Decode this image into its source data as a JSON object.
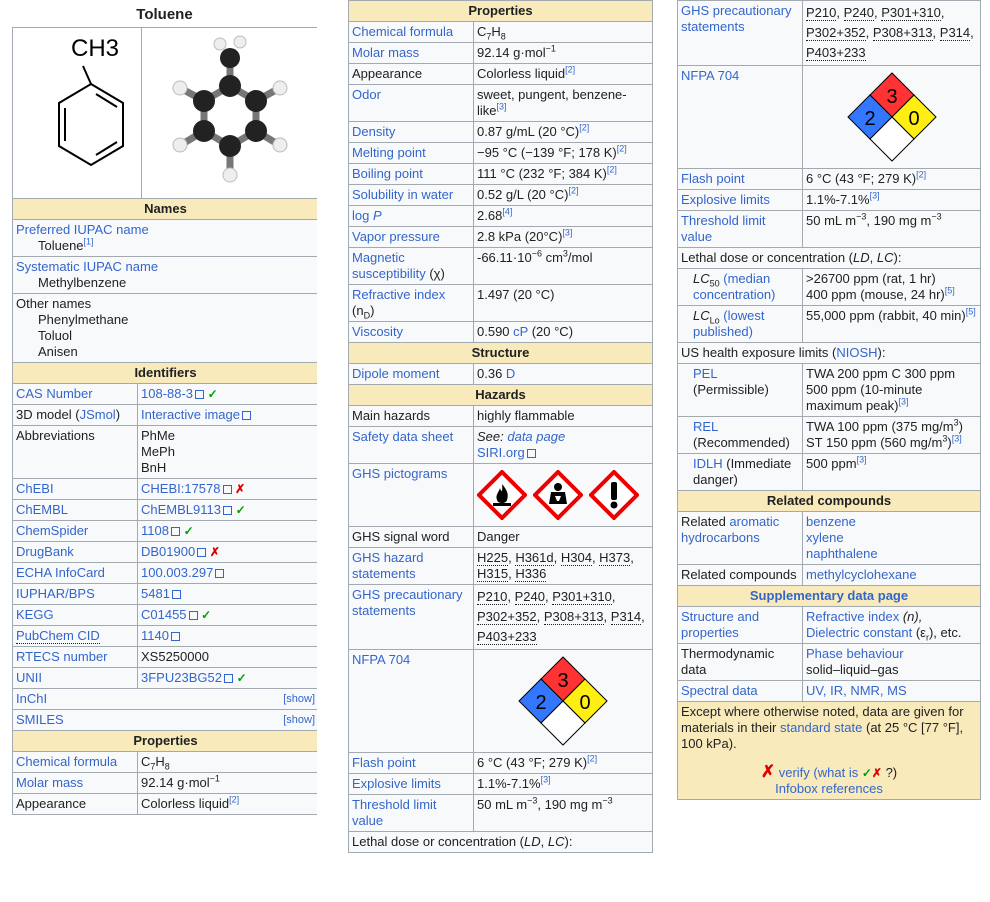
{
  "title": "Toluene",
  "structure": {
    "formula_label": "CH3"
  },
  "sections": {
    "names": "Names",
    "identifiers": "Identifiers",
    "properties": "Properties",
    "structure": "Structure",
    "hazards": "Hazards",
    "related": "Related compounds",
    "supplementary": "Supplementary data page"
  },
  "names": {
    "preferred_label": "Preferred IUPAC name",
    "preferred_value": "Toluene",
    "preferred_ref": "[1]",
    "systematic_label": "Systematic IUPAC name",
    "systematic_value": "Methylbenzene",
    "other_label": "Other names",
    "other_values": [
      "Phenylmethane",
      "Toluol",
      "Anisen"
    ]
  },
  "identifiers": {
    "cas_label": "CAS Number",
    "cas_value": "108-88-3",
    "model_label_a": "3D model (",
    "model_label_link": "JSmol",
    "model_label_b": ")",
    "model_value": "Interactive image",
    "abbr_label": "Abbreviations",
    "abbr_values": [
      "PhMe",
      "MePh",
      "BnH"
    ],
    "chebi_label": "ChEBI",
    "chebi_value": "CHEBI:17578",
    "chembl_label": "ChEMBL",
    "chembl_value": "ChEMBL9113",
    "chemspider_label": "ChemSpider",
    "chemspider_value": "1108",
    "drugbank_label": "DrugBank",
    "drugbank_value": "DB01900",
    "echa_label": "ECHA InfoCard",
    "echa_value": "100.003.297",
    "iuphar_label": "IUPHAR/BPS",
    "iuphar_value": "5481",
    "kegg_label": "KEGG",
    "kegg_value": "C01455",
    "pubchem_label": "PubChem CID",
    "pubchem_value": "1140",
    "rtecs_label": "RTECS number",
    "rtecs_value": "XS5250000",
    "unii_label": "UNII",
    "unii_value": "3FPU23BG52",
    "inchi_label": "InChI",
    "smiles_label": "SMILES",
    "show": "[show]"
  },
  "marks": {
    "check": "✓",
    "cross": "✗"
  },
  "properties": {
    "formula_label": "Chemical formula",
    "formula_c": "C",
    "formula_7": "7",
    "formula_h": "H",
    "formula_8": "8",
    "molar_label": "Molar mass",
    "molar_value": "92.14 g·mol",
    "molar_exp": "−1",
    "appearance_label": "Appearance",
    "appearance_value": "Colorless liquid",
    "appearance_ref": "[2]",
    "odor_label": "Odor",
    "odor_value": "sweet, pungent, benzene-like",
    "odor_ref": "[3]",
    "density_label": "Density",
    "density_value": "0.87 g/mL (20 °C)",
    "density_ref": "[2]",
    "melting_label": "Melting point",
    "melting_value": "−95 °C (−139 °F; 178 K)",
    "melting_ref": "[2]",
    "boiling_label": "Boiling point",
    "boiling_value": "111 °C (232 °F; 384 K)",
    "boiling_ref": "[2]",
    "solubility_label": "Solubility in water",
    "solubility_value": "0.52 g/L (20 °C)",
    "solubility_ref": "[2]",
    "logp_label_a": "log ",
    "logp_label_b": "P",
    "logp_value": "2.68",
    "logp_ref": "[4]",
    "vapor_label": "Vapor pressure",
    "vapor_value": "2.8 kPa (20°C)",
    "vapor_ref": "[3]",
    "magnetic_label": "Magnetic susceptibility",
    "magnetic_chi": "(χ)",
    "magnetic_value_a": "-66.11·10",
    "magnetic_exp": "−6",
    "magnetic_value_b": " cm",
    "magnetic_exp2": "3",
    "magnetic_value_c": "/mol",
    "refractive_label": "Refractive index",
    "refractive_n": "(n",
    "refractive_sub": "D",
    "refractive_close": ")",
    "refractive_value": "1.497 (20 °C)",
    "viscosity_label": "Viscosity",
    "viscosity_value": "0.590 ",
    "viscosity_cp": "cP",
    "viscosity_rest": " (20 °C)"
  },
  "structure_sec": {
    "dipole_label": "Dipole moment",
    "dipole_value": "0.36 ",
    "dipole_unit": "D"
  },
  "hazards": {
    "main_label": "Main hazards",
    "main_value": "highly flammable",
    "sds_label": "Safety data sheet",
    "sds_see": "See: ",
    "sds_link": "data page",
    "sds_siri": "SIRI.org",
    "pict_label": "GHS pictograms",
    "signal_label": "GHS signal word",
    "signal_value": "Danger",
    "hazard_label": "GHS hazard statements",
    "hazard_codes": [
      "H225",
      "H361d",
      "H304",
      "H373",
      "H315",
      "H336"
    ],
    "precaution_label": "GHS precautionary statements",
    "precaution_codes": [
      "P210",
      "P240",
      "P301+310",
      "P302+352",
      "P308+313",
      "P314",
      "P403+233"
    ],
    "nfpa_label": "NFPA 704",
    "nfpa_fire": "3",
    "nfpa_health": "2",
    "nfpa_react": "0",
    "flash_label": "Flash point",
    "flash_value": "6 °C (43 °F; 279 K)",
    "flash_ref": "[2]",
    "explosive_label": "Explosive limits",
    "explosive_value": "1.1%-7.1%",
    "explosive_ref": "[3]",
    "threshold_label": "Threshold limit value",
    "threshold_a": "50 mL m",
    "threshold_exp1": "−3",
    "threshold_b": ", 190 mg m",
    "threshold_exp2": "−3",
    "lethal_a": "Lethal dose or concentration (",
    "lethal_ld": "LD",
    "lethal_comma": ", ",
    "lethal_lc": "LC",
    "lethal_b": "):",
    "lc50_lc": "LC",
    "lc50_sub": "50",
    "lc50_link": "(median concentration)",
    "lc50_value_1": ">26700 ppm (rat, 1 hr)",
    "lc50_value_2": "400 ppm (mouse, 24 hr)",
    "lc50_ref": "[5]",
    "lclo_lc": "LC",
    "lclo_sub": "Lo",
    "lclo_link": "(lowest published)",
    "lclo_value": "55,000 ppm (rabbit, 40 min)",
    "lclo_ref": "[5]",
    "us_a": "US health exposure limits (",
    "us_link": "NIOSH",
    "us_b": "):",
    "pel_label": "PEL",
    "pel_sub": "(Permissible)",
    "pel_value_1": "TWA 200 ppm C 300 ppm",
    "pel_value_2": "500 ppm (10-minute maximum peak)",
    "pel_ref": "[3]",
    "rel_label": "REL",
    "rel_sub": "(Recommended)",
    "rel_value_1": "TWA 100 ppm (375 mg/m",
    "rel_exp1": "3",
    "rel_close1": ")",
    "rel_value_2": "ST 150 ppm (560 mg/m",
    "rel_exp2": "3",
    "rel_close2": ")",
    "rel_ref": "[3]",
    "idlh_label": "IDLH",
    "idlh_sub": " (Immediate danger)",
    "idlh_value": "500 ppm",
    "idlh_ref": "[3]"
  },
  "related": {
    "aromatic_label_a": "Related ",
    "aromatic_label_link": "aromatic hydrocarbons",
    "aromatic_values": [
      "benzene",
      "xylene",
      "naphthalene"
    ],
    "compounds_label": "Related compounds",
    "compounds_value": "methylcyclohexane"
  },
  "supplementary": {
    "struct_label": "Structure and properties",
    "struct_value_a": "Refractive index",
    "struct_value_n": " (n),",
    "struct_value_b": "Dielectric constant",
    "struct_value_eps": " (ε",
    "struct_value_r": "r",
    "struct_value_c": "), etc.",
    "thermo_label": "Thermodynamic data",
    "thermo_value_a": "Phase behaviour",
    "thermo_value_b": "solid–liquid–gas",
    "spectral_label": "Spectral data",
    "spectral_value": "UV, IR, NMR, MS"
  },
  "footer": {
    "note_a": "Except where otherwise noted, data are given for materials in their ",
    "note_link": "standard state",
    "note_b": " (at 25 °C [77 °F], 100 kPa).",
    "verify_x": "✗",
    "verify_link": "verify",
    "verify_what": "(what is ",
    "verify_check": "✓",
    "verify_cross": "✗",
    "verify_close": "?)",
    "refs": "Infobox references"
  },
  "colors": {
    "section_bg": "#f8eaba",
    "link": "#3366cc",
    "border": "#a2a9b1",
    "nfpa_red": "#ff3333",
    "nfpa_blue": "#3377ff",
    "nfpa_yellow": "#ffee11"
  }
}
